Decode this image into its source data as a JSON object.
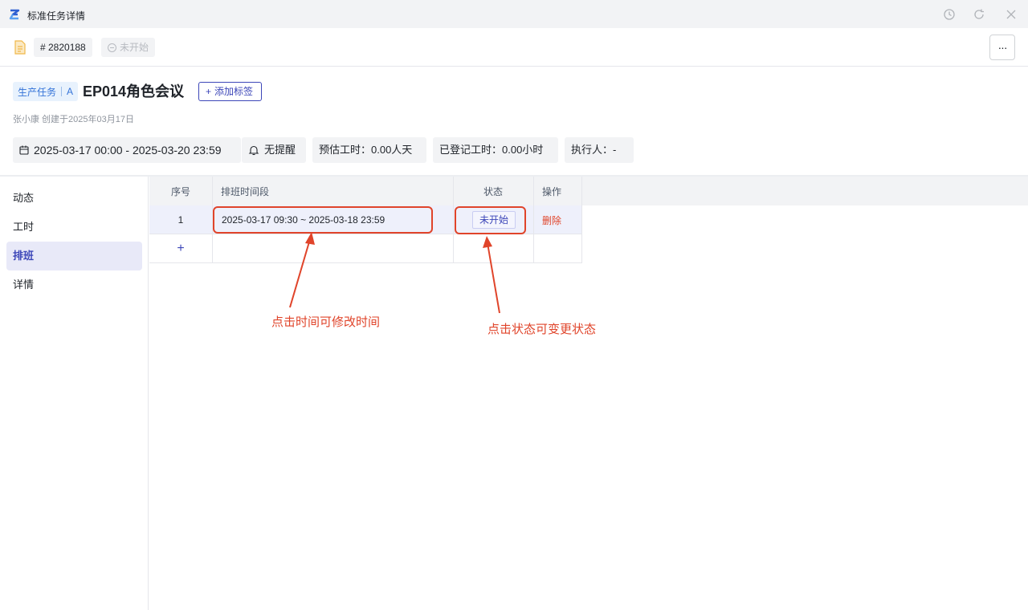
{
  "window": {
    "title": "标准任务详情",
    "controls": [
      {
        "name": "history",
        "glyph": "◷"
      },
      {
        "name": "refresh",
        "glyph": "↻"
      },
      {
        "name": "close",
        "glyph": "✕"
      }
    ]
  },
  "toolbar": {
    "task_id": "# 2820188",
    "status": "未开始",
    "more": "···"
  },
  "task": {
    "type_tag": "生产任务",
    "level_tag": "A",
    "title": "EP014角色会议",
    "add_tag_label": "添加标签",
    "add_tag_prefix": "+",
    "creator_line": "张小康 创建于2025年03月17日"
  },
  "info": {
    "date_range": "2025-03-17 00:00 - 2025-03-20 23:59",
    "reminder": "无提醒",
    "estimated": "预估工时：0.00人天",
    "logged": "已登记工时：0.00小时",
    "assignee": "执行人：-"
  },
  "sidebar": {
    "items": [
      {
        "label": "动态",
        "active": false
      },
      {
        "label": "工时",
        "active": false
      },
      {
        "label": "排班",
        "active": true
      },
      {
        "label": "详情",
        "active": false
      }
    ]
  },
  "schedule": {
    "headers": {
      "index": "序号",
      "period": "排班时间段",
      "status": "状态",
      "action": "操作"
    },
    "rows": [
      {
        "index": "1",
        "period": "2025-03-17 09:30 ~ 2025-03-18 23:59",
        "status": "未开始",
        "action": "删除"
      }
    ],
    "add_row": "+"
  },
  "annotations": {
    "time_hint": "点击时间可修改时间",
    "status_hint": "点击状态可变更状态"
  },
  "colors": {
    "accent": "#3c46b8",
    "danger": "#e0442a",
    "annotation": "#e0442a"
  }
}
